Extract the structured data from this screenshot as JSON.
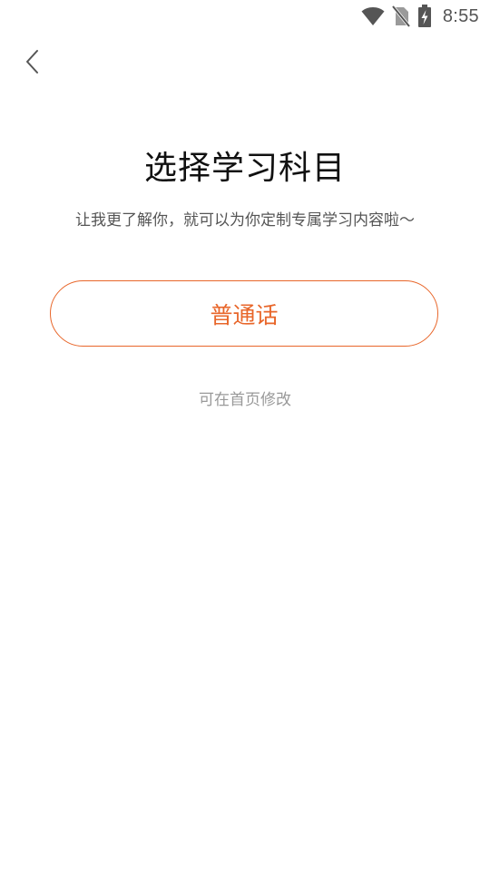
{
  "status_bar": {
    "time": "8:55",
    "icons": [
      "wifi-icon",
      "no-sim-icon",
      "battery-charging-icon"
    ]
  },
  "header": {
    "back_icon": "chevron-left-icon"
  },
  "main": {
    "title": "选择学习科目",
    "subtitle": "让我更了解你，就可以为你定制专属学习内容啦～",
    "subjects": [
      {
        "label": "普通话"
      }
    ],
    "hint": "可在首页修改"
  },
  "colors": {
    "accent": "#e8662a",
    "title": "#111111",
    "subtitle": "#555555",
    "hint": "#999999",
    "background": "#ffffff"
  }
}
